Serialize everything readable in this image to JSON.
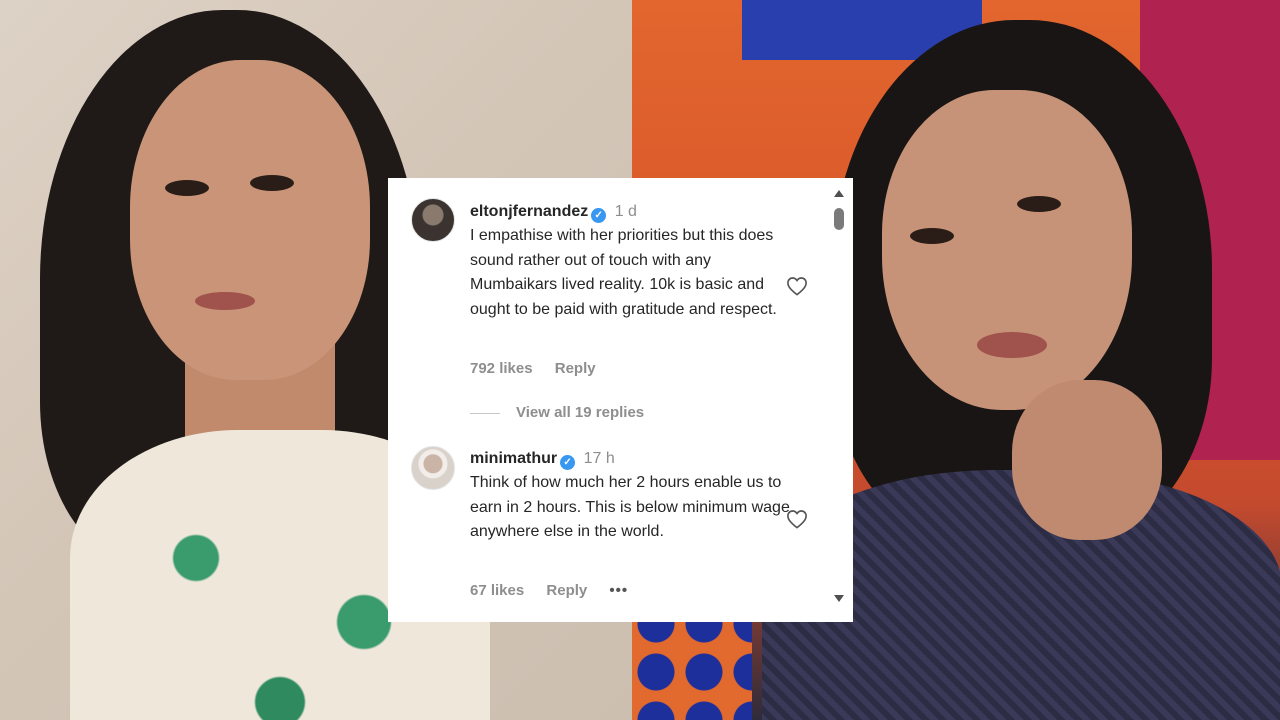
{
  "comments": [
    {
      "username": "eltonjfernandez",
      "verified_icon": "✓",
      "time": "1 d",
      "text": "I empathise with her priorities but this does sound rather out of touch with any Mumbaikars lived reality. 10k is basic and ought to be paid with gratitude and respect.",
      "likes": "792 likes",
      "reply": "Reply"
    },
    {
      "username": "minimathur",
      "verified_icon": "✓",
      "time": "17 h",
      "text": "Think of how much her 2 hours enable us to earn in 2 hours. This is below minimum wage anywhere else in the world.",
      "likes": "67 likes",
      "reply": "Reply",
      "more": "•••"
    }
  ],
  "view_replies": "View all 19 replies",
  "icons": {
    "heart": "heart-outline-icon",
    "verified": "verified-badge-icon"
  },
  "colors": {
    "verified": "#3897f0",
    "text": "#262626",
    "muted": "#8e8e8e"
  }
}
